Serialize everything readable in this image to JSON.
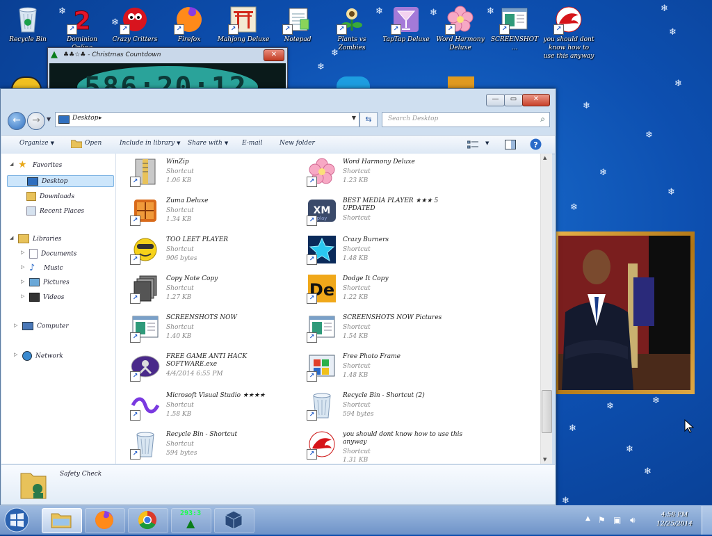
{
  "desktop": {
    "icons": [
      {
        "label": "Recycle Bin",
        "icon": "recycle-bin-icon"
      },
      {
        "label": "Dominion Online",
        "icon": "number-two-icon"
      },
      {
        "label": "Crazy Critters",
        "icon": "red-critter-icon"
      },
      {
        "label": "Firefox",
        "icon": "firefox-icon"
      },
      {
        "label": "Mahjong Deluxe",
        "icon": "torii-gate-icon"
      },
      {
        "label": "Notepad",
        "icon": "notepad-icon"
      },
      {
        "label": "Plants vs Zombies",
        "icon": "plant-icon"
      },
      {
        "label": "TapTap Deluxe",
        "icon": "cocktail-icon"
      },
      {
        "label": "Word Harmony Deluxe",
        "icon": "pink-flower-icon"
      },
      {
        "label": "SCREENSHOT ...",
        "icon": "screenshot-window-icon"
      },
      {
        "label": "you should dont know how to use this anyway",
        "icon": "red-dragon-icon"
      }
    ]
  },
  "clock_window": {
    "title": "♣♣☆♣ - Christmas Countdown",
    "close_label": "✕",
    "digits": "586:20:12"
  },
  "explorer": {
    "window_buttons": {
      "minimize": "—",
      "maximize": "▭",
      "close": "✕"
    },
    "address": {
      "path": "Desktop",
      "separator": "▸"
    },
    "search_placeholder": "Search Desktop",
    "toolbar": {
      "organize": "Organize",
      "open": "Open",
      "include": "Include in library",
      "share": "Share with",
      "email": "E-mail",
      "newfolder": "New folder"
    },
    "nav": {
      "favorites": "Favorites",
      "desktop": "Desktop",
      "downloads": "Downloads",
      "recent": "Recent Places",
      "libraries": "Libraries",
      "documents": "Documents",
      "music": "Music",
      "pictures": "Pictures",
      "videos": "Videos",
      "computer": "Computer",
      "network": "Network"
    },
    "files": [
      {
        "name": "WinZip",
        "type": "Shortcut",
        "size": "1.06 KB",
        "icon": "winzip-icon"
      },
      {
        "name": "Word Harmony Deluxe",
        "type": "Shortcut",
        "size": "1.23 KB",
        "icon": "pink-flower-icon"
      },
      {
        "name": "Zuma Deluxe",
        "type": "Shortcut",
        "size": "1.34 KB",
        "icon": "zuma-icon"
      },
      {
        "name": "BEST MEDIA PLAYER ★★★ 5 UPDATED",
        "type": "Shortcut",
        "size": "",
        "icon": "xmplay-icon"
      },
      {
        "name": "TOO LEET PLAYER",
        "type": "Shortcut",
        "size": "906 bytes",
        "icon": "yellow-smiley-icon"
      },
      {
        "name": "Crazy Burners",
        "type": "Shortcut",
        "size": "1.48 KB",
        "icon": "blue-star-icon"
      },
      {
        "name": "Copy Note Copy",
        "type": "Shortcut",
        "size": "1.27 KB",
        "icon": "stacked-pages-icon"
      },
      {
        "name": "Dodge It Copy",
        "type": "Shortcut",
        "size": "1.22 KB",
        "icon": "de-logo-icon"
      },
      {
        "name": "SCREENSHOTS NOW",
        "type": "Shortcut",
        "size": "1.40 KB",
        "icon": "screenshot-window-icon"
      },
      {
        "name": "SCREENSHOTS NOW Pictures",
        "type": "Shortcut",
        "size": "1.54 KB",
        "icon": "screenshot-window-icon"
      },
      {
        "name": "FREE GAME ANTI HACK SOFTWARE.exe",
        "type": "4/4/2014 6:55 PM",
        "size": "",
        "icon": "anti-hack-icon"
      },
      {
        "name": "Free Photo Frame",
        "type": "Shortcut",
        "size": "1.48 KB",
        "icon": "photo-frame-icon"
      },
      {
        "name": "Microsoft Visual Studio ★★★★",
        "type": "Shortcut",
        "size": "1.58 KB",
        "icon": "visual-studio-icon"
      },
      {
        "name": "Recycle Bin - Shortcut (2)",
        "type": "Shortcut",
        "size": "594 bytes",
        "icon": "recycle-bin-icon"
      },
      {
        "name": "Recycle Bin - Shortcut",
        "type": "Shortcut",
        "size": "594 bytes",
        "icon": "recycle-bin-icon"
      },
      {
        "name": "you should dont know how to use this anyway",
        "type": "Shortcut",
        "size": "1.31 KB",
        "icon": "red-dragon-icon"
      }
    ],
    "details_label": "Safety Check"
  },
  "taskbar": {
    "clock_badge": "293:3",
    "time": "4:58 PM",
    "date": "12/25/2014"
  }
}
